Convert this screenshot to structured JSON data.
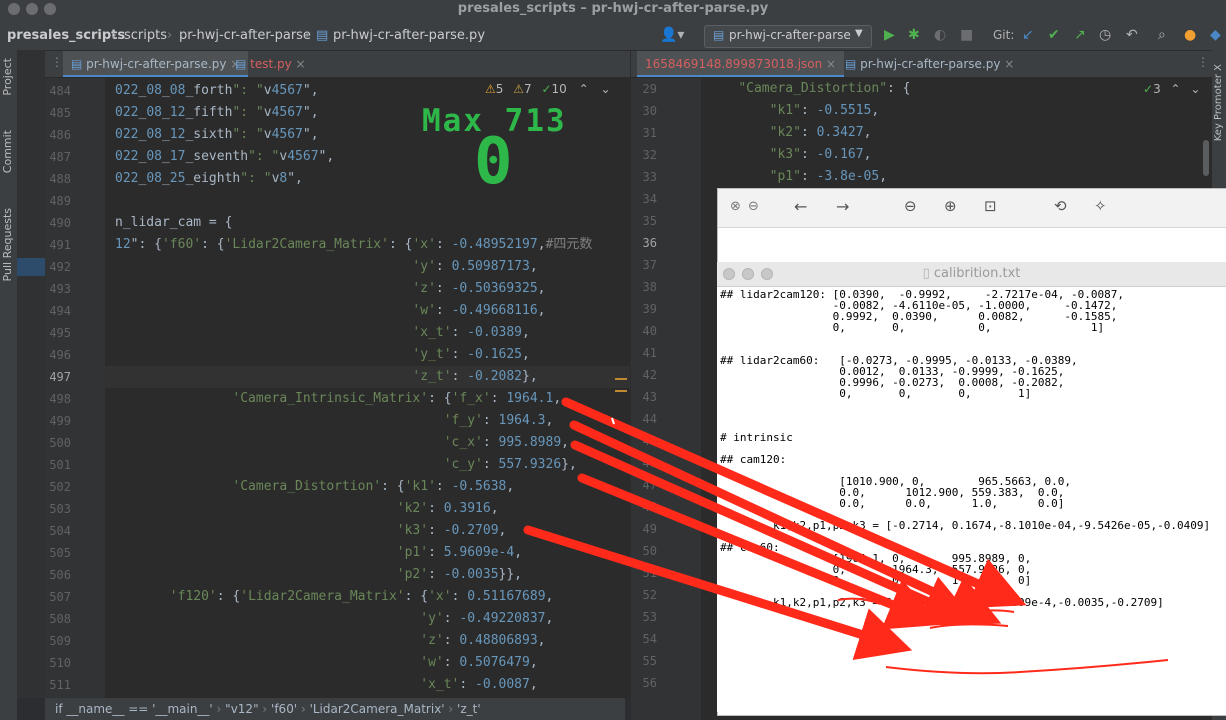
{
  "window": {
    "title": "presales_scripts – pr-hwj-cr-after-parse.py"
  },
  "breadcrumb": {
    "project": "presales_scripts",
    "folder": "scripts",
    "item": "pr-hwj-cr-after-parse",
    "file": "pr-hwj-cr-after-parse.py"
  },
  "toolbar": {
    "run_config": "pr-hwj-cr-after-parse",
    "git_label": "Git:"
  },
  "left_tools": {
    "project": "Project",
    "commit": "Commit",
    "pull_requests": "Pull Requests"
  },
  "right_tools": {
    "key_promoter": "Key Promoter X"
  },
  "left_tabs": [
    "pr-hwj-cr-after-parse.py",
    "test.py"
  ],
  "right_tabs": [
    "1658469148.899873018.json",
    "pr-hwj-cr-after-parse.py"
  ],
  "inspections_left": {
    "warnings": "5",
    "weak": "7",
    "ok": "10"
  },
  "inspections_right": {
    "ok": "3"
  },
  "left_editor": {
    "line_numbers": [
      "484",
      "485",
      "486",
      "487",
      "488",
      "489",
      "490",
      "491",
      "492",
      "493",
      "494",
      "495",
      "496",
      "497",
      "498",
      "499",
      "500",
      "501",
      "502",
      "503",
      "504",
      "505",
      "506",
      "507",
      "508",
      "509",
      "510",
      "511"
    ],
    "lines": [
      "022_08_08_forth\": \"v4567\",",
      "022_08_12_fifth\": \"v4567\",",
      "022_08_12_sixth\": \"v4567\",",
      "022_08_17_seventh\": \"v4567\",",
      "022_08_25_eighth\": \"v8\",",
      "",
      "n_lidar_cam = {",
      "12\": {'f60': {'Lidar2Camera_Matrix': {'x': -0.48952197,#四元数",
      "                                      'y': 0.50987173,",
      "                                      'z': -0.50369325,",
      "                                      'w': -0.49668116,",
      "                                      'x_t': -0.0389,",
      "                                      'y_t': -0.1625,",
      "                                      'z_t': -0.2082},",
      "               'Camera_Intrinsic_Matrix': {'f_x': 1964.1,",
      "                                          'f_y': 1964.3,",
      "                                          'c_x': 995.8989,",
      "                                          'c_y': 557.9326},",
      "               'Camera_Distortion': {'k1': -0.5638,",
      "                                    'k2': 0.3916,",
      "                                    'k3': -0.2709,",
      "                                    'p1': 5.9609e-4,",
      "                                    'p2': -0.0035}},",
      "       'f120': {'Lidar2Camera_Matrix': {'x': 0.51167689,",
      "                                       'y': -0.49220837,",
      "                                       'z': 0.48806893,",
      "                                       'w': 0.5076479,",
      "                                       'x_t': -0.0087,"
    ]
  },
  "right_editor": {
    "line_numbers": [
      "29",
      "30",
      "31",
      "32",
      "33",
      "34",
      "35",
      "36",
      "37",
      "38",
      "39",
      "40",
      "41",
      "42",
      "43",
      "44",
      "45",
      "46",
      "47",
      "48",
      "49",
      "50",
      "51",
      "52",
      "53",
      "54",
      "55",
      "56"
    ],
    "lines": [
      "    \"Camera_Distortion\": {",
      "        \"k1\": -0.5515,",
      "        \"k2\": 0.3427,",
      "        \"k3\": -0.167,",
      "        \"p1\": -3.8e-05,"
    ]
  },
  "overlay": {
    "max_label": "Max 713",
    "score": "0"
  },
  "viewer": {
    "title": "calibrition.txt"
  },
  "calib_text": [
    "## lidar2cam120: [0.0390,  -0.9992,     -2.7217e-04, -0.0087,",
    "                 -0.0082, -4.6110e-05, -1.0000,     -0.1472,",
    "                 0.9992,  0.0390,      0.0082,      -0.1585,",
    "                 0,       0,           0,               1]",
    "",
    "",
    "## lidar2cam60:   [-0.0273, -0.9995, -0.0133, -0.0389,",
    "                  0.0012,  0.0133, -0.9999, -0.1625,",
    "                  0.9996, -0.0273,  0.0008, -0.2082,",
    "                  0,       0,       0,       1]",
    "",
    "",
    "",
    "# intrinsic",
    "",
    "## cam120:",
    "",
    "                  [1010.900, 0,        965.5663, 0.0,",
    "                  0.0,      1012.900, 559.383,  0.0,",
    "                  0.0,      0.0,      1.0,      0.0]",
    "",
    "        k1,k2,p1,p2,k3 = [-0.2714, 0.1674,-8.1010e-04,-9.5426e-05,-0.0409]",
    "",
    "## cam60:",
    "                 [1964.1, 0,       995.8989, 0,",
    "                 0,       1964.3,  557.9326, 0,",
    "                 0,       0,       1,        0]",
    "",
    "        k1,k2,p1,p2,k3 = [-0.5638,0.3916,5.9609e-4,-0.0035,-0.2709]"
  ],
  "statusbar": {
    "crumbs": [
      "if __name__ == '__main__'",
      "\"v12\"",
      "'f60'",
      "'Lidar2Camera_Matrix'",
      "'z_t'"
    ]
  },
  "colors": {
    "arrow": "#ff2a1a",
    "score": "#2fb84a"
  }
}
